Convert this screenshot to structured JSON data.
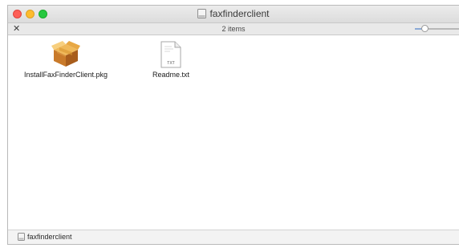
{
  "window": {
    "title": "faxfinderclient"
  },
  "toolbar": {
    "tools_icon": "tools-icon",
    "item_count": "2 items",
    "icon_size_slider_level": 0.25
  },
  "files": [
    {
      "name": "InstallFaxFinderClient.pkg",
      "icon": "package-icon"
    },
    {
      "name": "Readme.txt",
      "icon": "text-document-icon",
      "badge": "TXT"
    }
  ],
  "pathbar": {
    "items": [
      {
        "label": "faxfinderclient",
        "icon": "disk-image-icon"
      }
    ]
  },
  "colors": {
    "close": "#fd5f57",
    "minimize": "#fdbc2e",
    "maximize": "#27c840",
    "slider_accent": "#8aa9d6"
  }
}
